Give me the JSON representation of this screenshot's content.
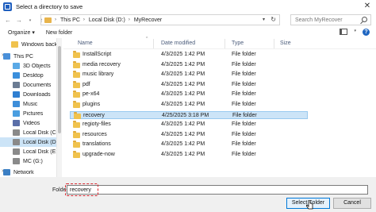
{
  "window": {
    "title": "Select a directory to save"
  },
  "address": {
    "segments": [
      "This PC",
      "Local Disk (D:)",
      "MyRecover"
    ]
  },
  "search": {
    "placeholder": "Search MyRecover"
  },
  "toolbar": {
    "organize": "Organize ▾",
    "new_folder": "New folder"
  },
  "nav": {
    "items": [
      {
        "label": "Windows backu",
        "icon": "folder-icon",
        "color": "#f0c24d"
      },
      {
        "label": "This PC",
        "icon": "pc-icon",
        "color": "#4a90d9"
      },
      {
        "label": "3D Objects",
        "icon": "cube-icon",
        "color": "#5aa9e6"
      },
      {
        "label": "Desktop",
        "icon": "desktop-icon",
        "color": "#3b8fdc"
      },
      {
        "label": "Documents",
        "icon": "documents-icon",
        "color": "#6b7c93"
      },
      {
        "label": "Downloads",
        "icon": "download-icon",
        "color": "#2f7fd1"
      },
      {
        "label": "Music",
        "icon": "music-icon",
        "color": "#3e8ed9"
      },
      {
        "label": "Pictures",
        "icon": "pictures-icon",
        "color": "#4a9ee0"
      },
      {
        "label": "Videos",
        "icon": "videos-icon",
        "color": "#5a6ea8"
      },
      {
        "label": "Local Disk (C:)",
        "icon": "drive-icon",
        "color": "#8a8a8a"
      },
      {
        "label": "Local Disk (D:)",
        "icon": "drive-icon",
        "color": "#8a8a8a"
      },
      {
        "label": "Local Disk (E:)",
        "icon": "drive-icon",
        "color": "#8a8a8a"
      },
      {
        "label": "MC (G:)",
        "icon": "drive-icon",
        "color": "#8a8a8a"
      },
      {
        "label": "Network",
        "icon": "network-icon",
        "color": "#3b7fc4"
      }
    ]
  },
  "columns": {
    "name": "Name",
    "date": "Date modified",
    "type": "Type",
    "size": "Size"
  },
  "files": [
    {
      "name": "InstallScript",
      "date": "4/3/2025 1:42 PM",
      "type": "File folder"
    },
    {
      "name": "media recovery",
      "date": "4/3/2025 1:42 PM",
      "type": "File folder"
    },
    {
      "name": "music library",
      "date": "4/3/2025 1:42 PM",
      "type": "File folder"
    },
    {
      "name": "pdf",
      "date": "4/3/2025 1:42 PM",
      "type": "File folder"
    },
    {
      "name": "pe-x64",
      "date": "4/3/2025 1:42 PM",
      "type": "File folder"
    },
    {
      "name": "plugins",
      "date": "4/3/2025 1:42 PM",
      "type": "File folder"
    },
    {
      "name": "recovery",
      "date": "4/25/2025 3:18 PM",
      "type": "File folder",
      "selected": true
    },
    {
      "name": "regioty-files",
      "date": "4/3/2025 1:42 PM",
      "type": "File folder"
    },
    {
      "name": "resources",
      "date": "4/3/2025 1:42 PM",
      "type": "File folder"
    },
    {
      "name": "translations",
      "date": "4/3/2025 1:42 PM",
      "type": "File folder"
    },
    {
      "name": "upgrade-now",
      "date": "4/3/2025 1:42 PM",
      "type": "File folder"
    }
  ],
  "footer": {
    "folder_label": "Folder:",
    "folder_value": "recovery",
    "select_button": "Select Folder",
    "cancel_button": "Cancel"
  },
  "colors": {
    "selection": "#cce4f7",
    "accent": "#0078d7",
    "highlight": "#d7262e"
  }
}
